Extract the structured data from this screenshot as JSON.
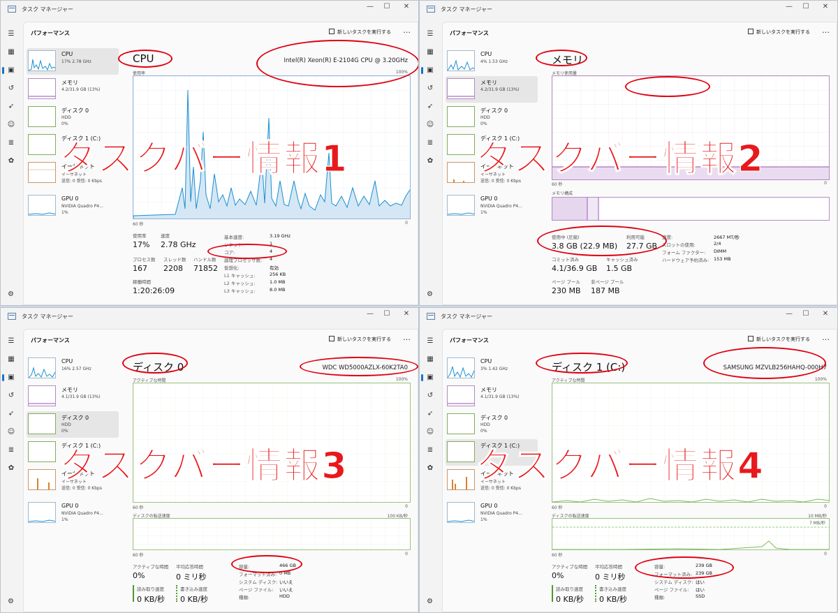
{
  "app_title": "タスク マネージャー",
  "header_title": "パフォーマンス",
  "new_task_label": "新しいタスクを実行する",
  "more_label": "…",
  "window_controls": {
    "minimize": "—",
    "maximize": "☐",
    "close": "✕"
  },
  "colors": {
    "accent": "#1a73c8",
    "cpu": "#1a8fd0",
    "memory": "#9b4fb5",
    "disk": "#4d9a2a",
    "annotation": "#e00010"
  },
  "panels": [
    {
      "sidebar": [
        {
          "name": "CPU",
          "sub": "17% 2.78 GHz",
          "sub2": "",
          "kind": "cpu",
          "selected": true
        },
        {
          "name": "メモリ",
          "sub": "4.2/31.9 GB (13%)",
          "sub2": "",
          "kind": "mem",
          "selected": false
        },
        {
          "name": "ディスク 0",
          "sub": "HDD",
          "sub2": "0%",
          "kind": "disk",
          "selected": false
        },
        {
          "name": "ディスク 1 (C:)",
          "sub": "",
          "sub2": "",
          "kind": "disk",
          "selected": false
        },
        {
          "name": "イーサネット",
          "sub": "イーサネット",
          "sub2": "送信: 0 受信: 0 Kbps",
          "kind": "net",
          "selected": false
        },
        {
          "name": "GPU 0",
          "sub": "NVIDIA Quadro P4...",
          "sub2": "1%",
          "kind": "cpu",
          "selected": false
        }
      ],
      "title": "CPU",
      "model": "Intel(R) Xeon(R) E-2104G CPU @ 3.20GHz",
      "graph_label": "使用率",
      "graph_max": "100%",
      "graph_time": "60 秒",
      "graph_min": "0",
      "stats": [
        {
          "label": "使用率",
          "value": "17%"
        },
        {
          "label": "速度",
          "value": "2.78 GHz"
        },
        {
          "label": "プロセス数",
          "value": "167"
        },
        {
          "label": "スレッド数",
          "value": "2208"
        },
        {
          "label": "ハンドル数",
          "value": "71852"
        },
        {
          "label": "稼働時間",
          "value": "1:20:26:09"
        }
      ],
      "details": [
        {
          "k": "基本速度:",
          "v": "3.19 GHz"
        },
        {
          "k": "ソケット:",
          "v": "1"
        },
        {
          "k": "コア:",
          "v": "4"
        },
        {
          "k": "論理プロセッサ数:",
          "v": "4"
        },
        {
          "k": "仮想化:",
          "v": "有効"
        },
        {
          "k": "L1 キャッシュ:",
          "v": "256 KB"
        },
        {
          "k": "L2 キャッシュ:",
          "v": "1.0 MB"
        },
        {
          "k": "L3 キャッシュ:",
          "v": "8.0 MB"
        }
      ],
      "overlay": "タスクバー情報1"
    },
    {
      "sidebar": [
        {
          "name": "CPU",
          "sub": "4% 1.53 GHz",
          "sub2": "",
          "kind": "cpu",
          "selected": false
        },
        {
          "name": "メモリ",
          "sub": "4.2/31.9 GB (13%)",
          "sub2": "",
          "kind": "mem",
          "selected": true
        },
        {
          "name": "ディスク 0",
          "sub": "HDD",
          "sub2": "0%",
          "kind": "disk",
          "selected": false
        },
        {
          "name": "ディスク 1 (C:)",
          "sub": "",
          "sub2": "",
          "kind": "disk",
          "selected": false
        },
        {
          "name": "イーサネット",
          "sub": "イーサネット",
          "sub2": "送信: 0 受信: 0 Kbps",
          "kind": "net",
          "selected": false
        },
        {
          "name": "GPU 0",
          "sub": "NVIDIA Quadro P4...",
          "sub2": "1%",
          "kind": "cpu",
          "selected": false
        }
      ],
      "title": "メモリ",
      "graph_label": "メモリ使用量",
      "graph_time": "60 秒",
      "graph_min": "0",
      "composition_label": "メモリ構成",
      "stats": [
        {
          "label": "使用中 (圧縮)",
          "value": "3.8 GB (22.9 MB)"
        },
        {
          "label": "利用可能",
          "value": "27.7 GB"
        },
        {
          "label": "コミット済み",
          "value": "4.1/36.9 GB"
        },
        {
          "label": "キャッシュ済み",
          "value": "1.5 GB"
        },
        {
          "label": "ページ プール",
          "value": "230 MB"
        },
        {
          "label": "非ページ プール",
          "value": "187 MB"
        }
      ],
      "details": [
        {
          "k": "速度:",
          "v": "2667 MT/秒"
        },
        {
          "k": "スロットの使用:",
          "v": "2/4"
        },
        {
          "k": "フォーム ファクター:",
          "v": "DIMM"
        },
        {
          "k": "ハードウェア予約済み:",
          "v": "153 MB"
        }
      ],
      "overlay": "タスクバー情報2"
    },
    {
      "sidebar": [
        {
          "name": "CPU",
          "sub": "16% 2.57 GHz",
          "sub2": "",
          "kind": "cpu",
          "selected": false
        },
        {
          "name": "メモリ",
          "sub": "4.1/31.9 GB (13%)",
          "sub2": "",
          "kind": "mem",
          "selected": false
        },
        {
          "name": "ディスク 0",
          "sub": "HDD",
          "sub2": "0%",
          "kind": "disk",
          "selected": true
        },
        {
          "name": "ディスク 1 (C:)",
          "sub": "",
          "sub2": "",
          "kind": "disk",
          "selected": false
        },
        {
          "name": "イーサネット",
          "sub": "イーサネット",
          "sub2": "送信: 0 受信: 0 Kbps",
          "kind": "net",
          "selected": false
        },
        {
          "name": "GPU 0",
          "sub": "NVIDIA Quadro P4...",
          "sub2": "1%",
          "kind": "cpu",
          "selected": false
        }
      ],
      "title": "ディスク 0",
      "model": "WDC WD5000AZLX-60K2TA0",
      "graph_label": "アクティブな時間",
      "graph_max": "100%",
      "graph_time": "60 秒",
      "graph_min": "0",
      "graph2_label": "ディスクの転送速度",
      "graph2_max": "100 KB/秒",
      "stats": [
        {
          "label": "アクティブな時間",
          "value": "0%"
        },
        {
          "label": "平均応答時間",
          "value": "0 ミリ秒"
        },
        {
          "label": "読み取り速度",
          "value": "0 KB/秒"
        },
        {
          "label": "書き込み速度",
          "value": "0 KB/秒"
        }
      ],
      "details": [
        {
          "k": "容量:",
          "v": "466 GB"
        },
        {
          "k": "フォーマット済み:",
          "v": "0 MB"
        },
        {
          "k": "システム ディスク:",
          "v": "いいえ"
        },
        {
          "k": "ページ ファイル:",
          "v": "いいえ"
        },
        {
          "k": "種類:",
          "v": "HDD"
        }
      ],
      "overlay": "タスクバー情報3"
    },
    {
      "sidebar": [
        {
          "name": "CPU",
          "sub": "3% 1.42 GHz",
          "sub2": "",
          "kind": "cpu",
          "selected": false
        },
        {
          "name": "メモリ",
          "sub": "4.1/31.9 GB (13%)",
          "sub2": "",
          "kind": "mem",
          "selected": false
        },
        {
          "name": "ディスク 0",
          "sub": "HDD",
          "sub2": "0%",
          "kind": "disk",
          "selected": false
        },
        {
          "name": "ディスク 1 (C:)",
          "sub": "",
          "sub2": "",
          "kind": "disk",
          "selected": true
        },
        {
          "name": "イーサネット",
          "sub": "イーサネット",
          "sub2": "送信: 0 受信: 0 Kbps",
          "kind": "net",
          "selected": false
        },
        {
          "name": "GPU 0",
          "sub": "NVIDIA Quadro P4...",
          "sub2": "1%",
          "kind": "cpu",
          "selected": false
        }
      ],
      "title": "ディスク 1 (C:)",
      "model": "SAMSUNG MZVLB256HAHQ-000H7",
      "graph_label": "アクティブな時間",
      "graph_max": "100%",
      "graph_time": "60 秒",
      "graph_min": "0",
      "graph2_label": "ディスクの転送速度",
      "graph2_max": "10 MB/秒",
      "graph2_mid": "7 MB/秒",
      "stats": [
        {
          "label": "アクティブな時間",
          "value": "0%"
        },
        {
          "label": "平均応答時間",
          "value": "0 ミリ秒"
        },
        {
          "label": "読み取り速度",
          "value": "0 KB/秒"
        },
        {
          "label": "書き込み速度",
          "value": "0 KB/秒"
        }
      ],
      "details": [
        {
          "k": "容量:",
          "v": "239 GB"
        },
        {
          "k": "フォーマット済み:",
          "v": "239 GB"
        },
        {
          "k": "システム ディスク:",
          "v": "はい"
        },
        {
          "k": "ページ ファイル:",
          "v": "はい"
        },
        {
          "k": "種類:",
          "v": "SSD"
        }
      ],
      "overlay": "タスクバー情報4"
    }
  ]
}
